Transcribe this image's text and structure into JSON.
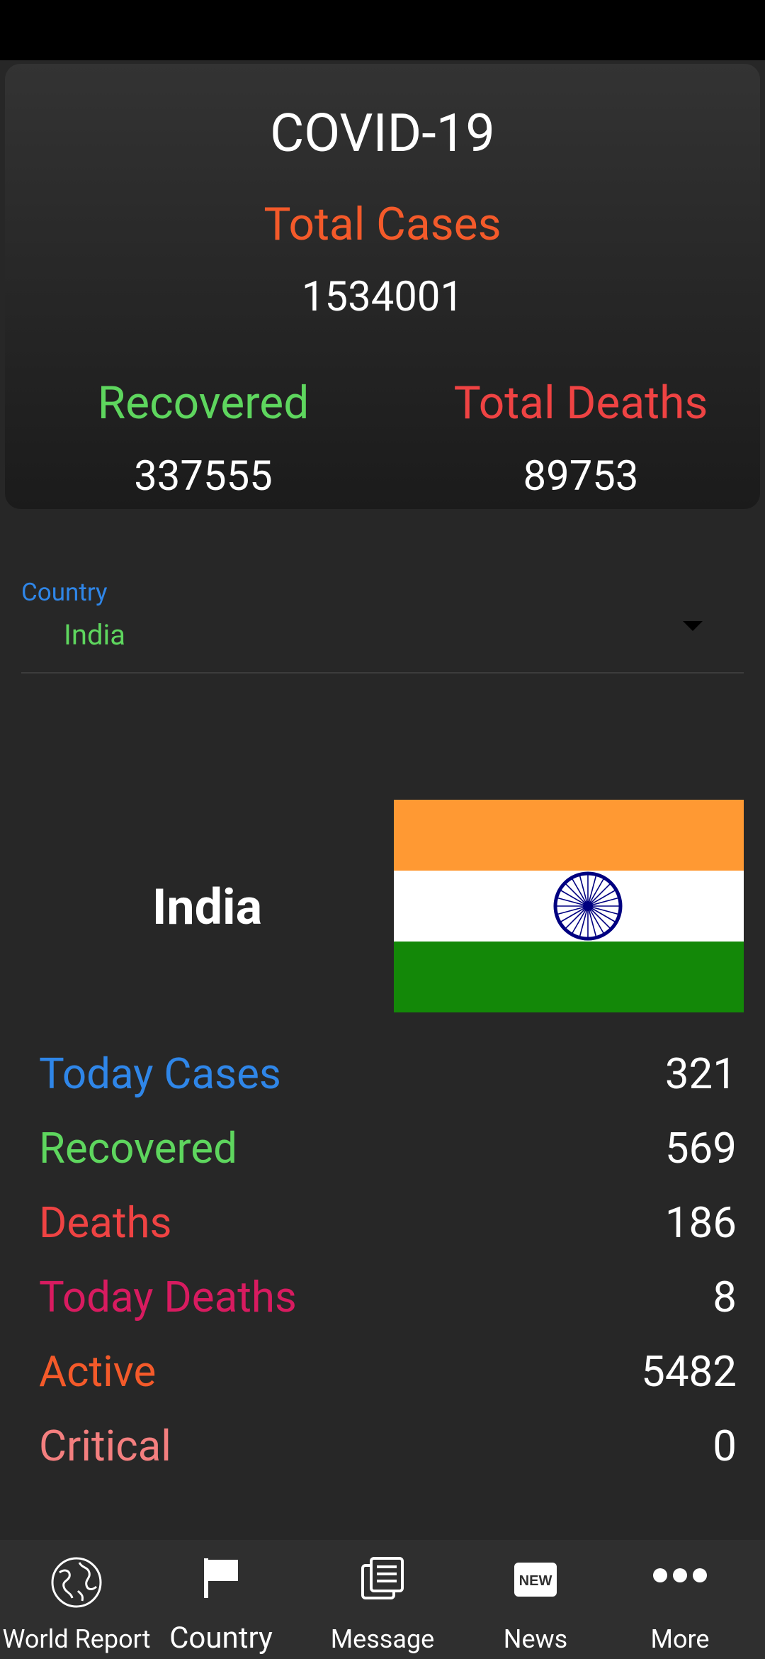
{
  "summary": {
    "title": "COVID-19",
    "total_cases_label": "Total Cases",
    "total_cases_value": "1534001",
    "recovered_label": "Recovered",
    "recovered_value": "337555",
    "total_deaths_label": "Total Deaths",
    "total_deaths_value": "89753"
  },
  "country_select": {
    "label": "Country",
    "value": "India"
  },
  "country_detail": {
    "name": "India",
    "flag_icon": "india-flag",
    "stats": [
      {
        "label": "Today Cases",
        "value": "321",
        "color": "#2f86e8"
      },
      {
        "label": "Recovered",
        "value": "569",
        "color": "#5ed65e"
      },
      {
        "label": "Deaths",
        "value": "186",
        "color": "#ef4343"
      },
      {
        "label": "Today Deaths",
        "value": "8",
        "color": "#d81b60"
      },
      {
        "label": "Active",
        "value": "5482",
        "color": "#f45a2a"
      },
      {
        "label": "Critical",
        "value": "0",
        "color": "#f47f7f"
      }
    ]
  },
  "nav": {
    "world_report": "World Report",
    "country": "Country",
    "message": "Message",
    "news": "News",
    "news_badge": "NEW",
    "more": "More"
  },
  "colors": {
    "total_cases": "#f45a2a",
    "recovered": "#5ed65e",
    "deaths": "#ef4343",
    "country_label": "#2f86e8",
    "country_value": "#5ed65e"
  }
}
